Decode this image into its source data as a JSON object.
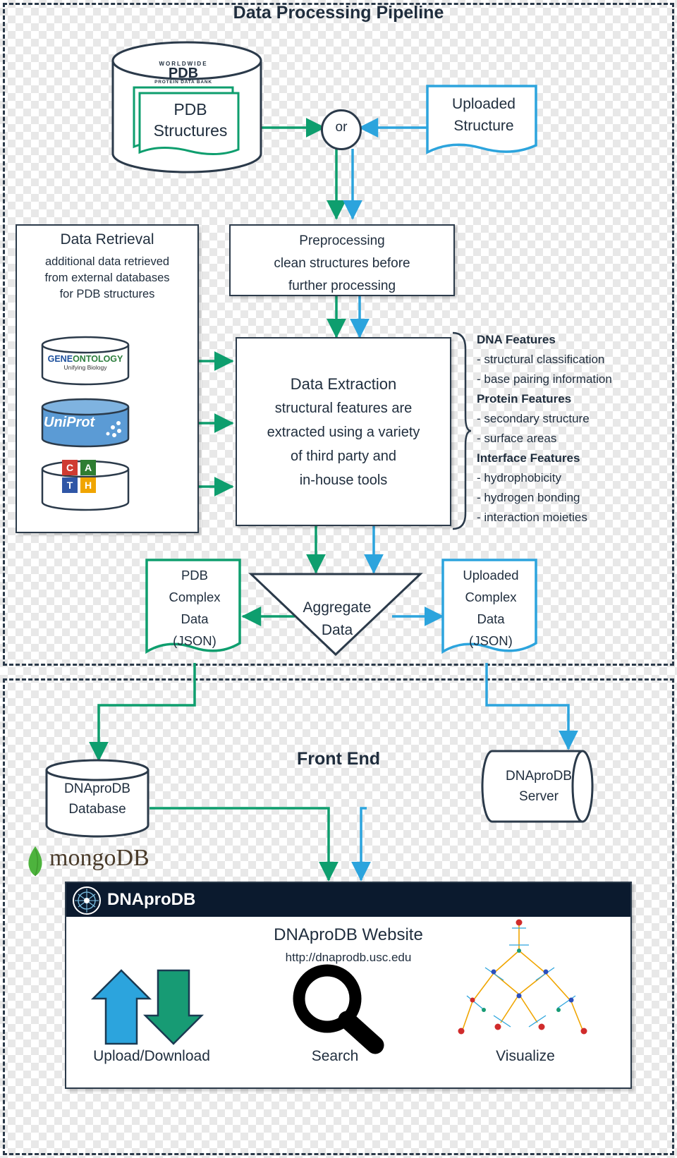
{
  "sections": {
    "pipeline_title": "Data Processing Pipeline",
    "frontend_title": "Front End"
  },
  "nodes": {
    "pdb_structures": {
      "line1": "PDB",
      "line2": "Structures",
      "logo_top": "WORLDWIDE",
      "logo_main": "PDB",
      "logo_sub": "PROTEIN DATA BANK"
    },
    "or_node": "or",
    "uploaded_structure": {
      "line1": "Uploaded",
      "line2": "Structure"
    },
    "preprocessing": {
      "title": "Preprocessing",
      "line2": "clean structures before",
      "line3": "further processing"
    },
    "data_retrieval": {
      "title": "Data Retrieval",
      "line1": "additional data retrieved",
      "line2": "from external databases",
      "line3": "for PDB structures",
      "db1": {
        "name1": "GENE",
        "name2": "ONTOLOGY",
        "sub": "Unifying Biology"
      },
      "db2": {
        "name": "UniProt"
      },
      "db3": {
        "c": "C",
        "a": "A",
        "t": "T",
        "h": "H"
      }
    },
    "data_extraction": {
      "title": "Data Extraction",
      "line2": "structural features are",
      "line3": "extracted using a variety",
      "line4": "of third party and",
      "line5": "in-house tools"
    },
    "features": {
      "dna_header": "DNA Features",
      "dna_items": [
        "- structural classification",
        "- base pairing information"
      ],
      "protein_header": "Protein Features",
      "protein_items": [
        "- secondary structure",
        "- surface areas"
      ],
      "interface_header": "Interface Features",
      "interface_items": [
        "- hydrophobicity",
        "- hydrogen bonding",
        "- interaction moieties"
      ]
    },
    "aggregate": {
      "line1": "Aggregate",
      "line2": "Data"
    },
    "pdb_complex": {
      "line1": "PDB",
      "line2": "Complex",
      "line3": "Data",
      "line4": "(JSON)"
    },
    "uploaded_complex": {
      "line1": "Uploaded",
      "line2": "Complex",
      "line3": "Data",
      "line4": "(JSON)"
    },
    "dnaprodb_database": {
      "line1": "DNAproDB",
      "line2": "Database"
    },
    "dnaprodb_server": {
      "line1": "DNAproDB",
      "line2": "Server"
    },
    "mongodb_label": "mongoDB"
  },
  "website": {
    "navbar_title": "DNAproDB",
    "heading": "DNAproDB Website",
    "url": "http://dnaprodb.usc.edu",
    "features": [
      "Upload/Download",
      "Search",
      "Visualize"
    ]
  },
  "colors": {
    "green": "#0e9e6e",
    "blue": "#2ca4dd",
    "dark": "#2b3a4a",
    "navbar": "#0b1a2e"
  }
}
